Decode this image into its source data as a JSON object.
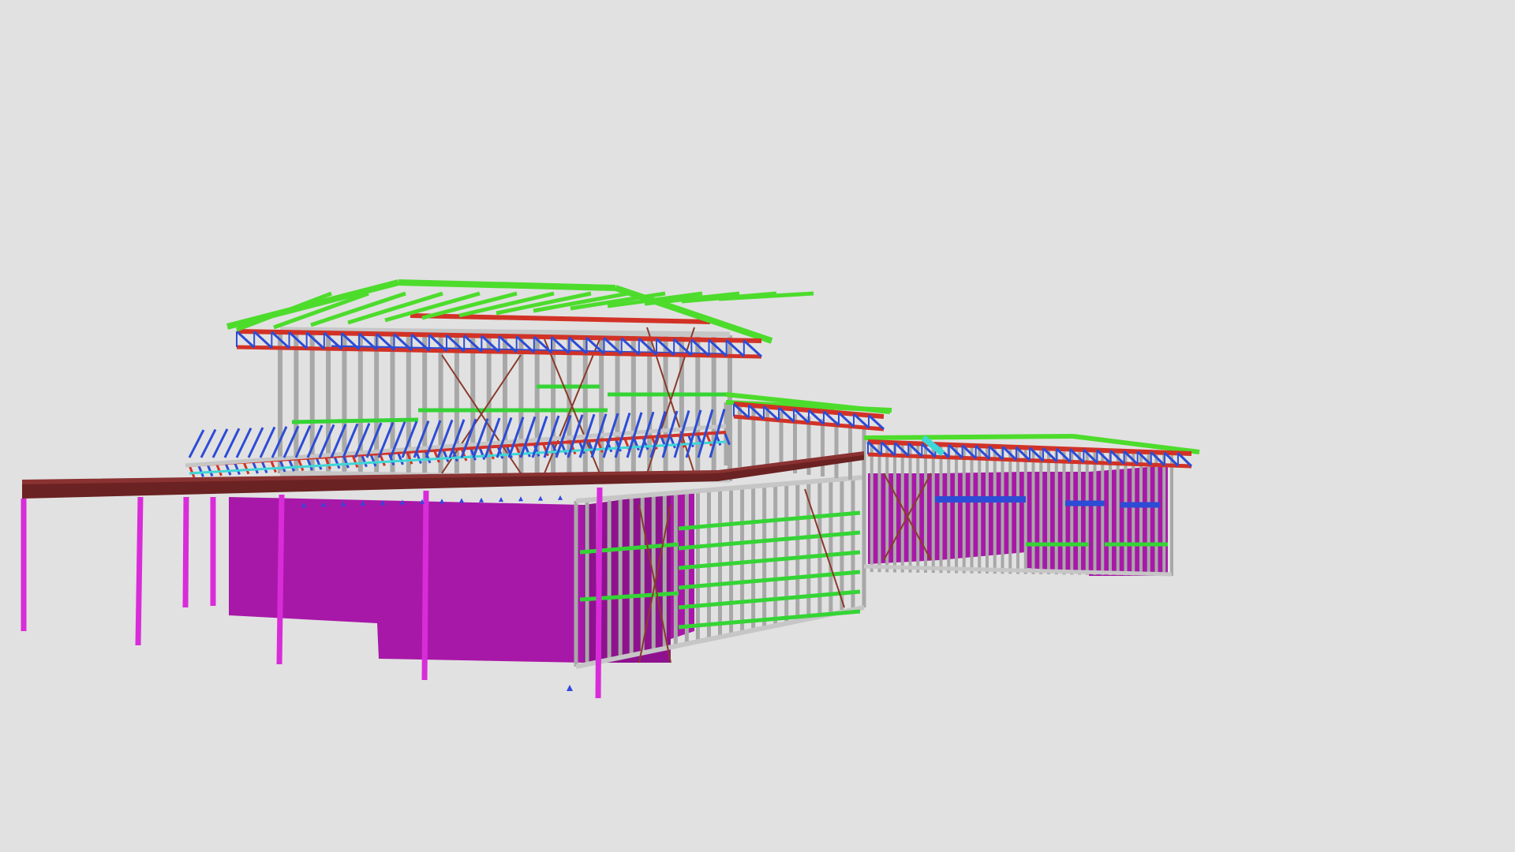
{
  "viewer": {
    "background_color": "#e1e1e1"
  },
  "model": {
    "kind": "steel-frame-building-3d-model",
    "colors": {
      "slab": "#a818a8",
      "slab_side": "#8e128e",
      "post": "#d92cd9",
      "deck_beam": "#6b2222",
      "deck_beam_top": "#8a3232",
      "stud": "#a8a8a8",
      "stud_light": "#c6c6c6",
      "nogging": "#35d435",
      "roof_green": "#4ddc2c",
      "truss_blue": "#2c4cd6",
      "truss_red": "#d23226",
      "brace": "#8a3a2a",
      "cyan": "#3fd6d6",
      "anchor": "#3048e0"
    }
  }
}
